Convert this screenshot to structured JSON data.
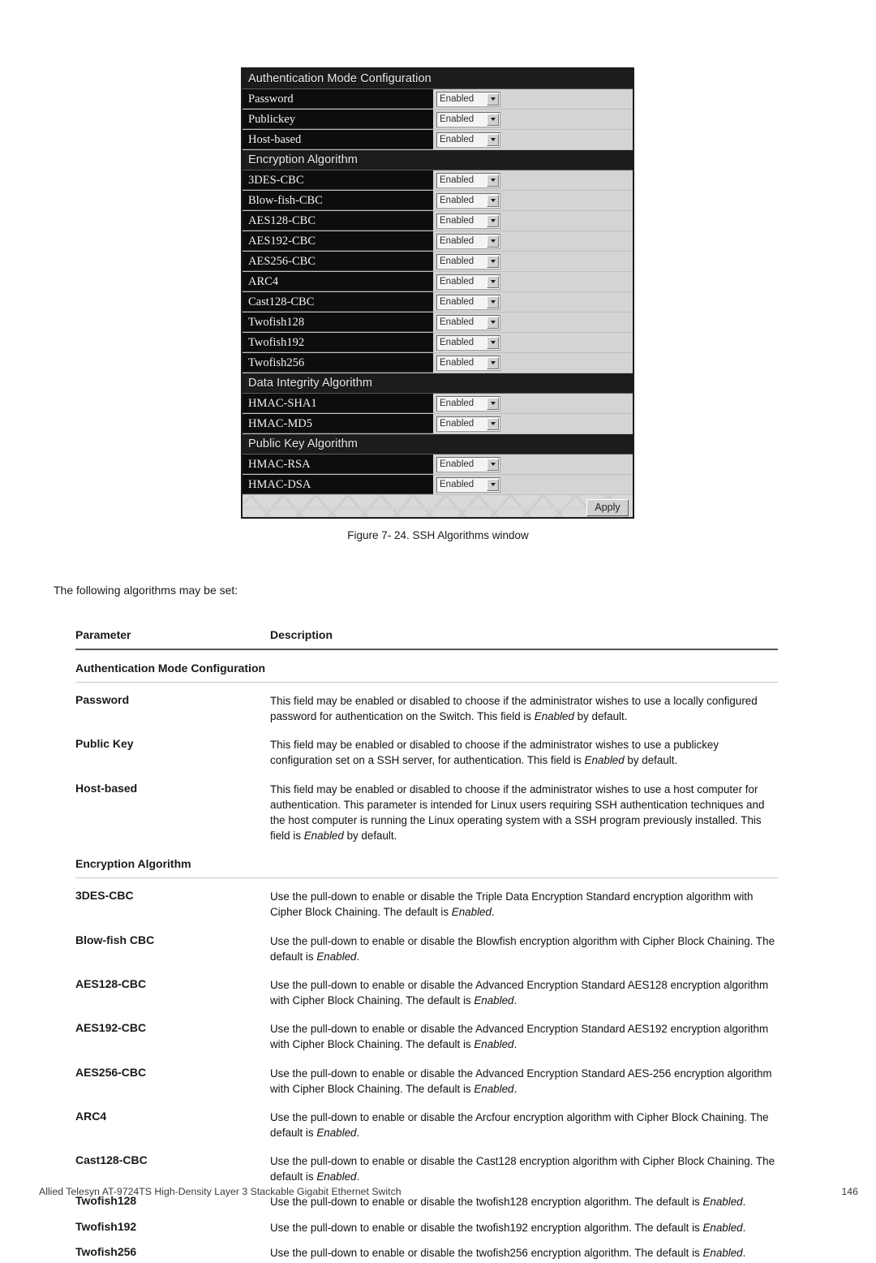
{
  "figure": {
    "caption": "Figure 7- 24. SSH Algorithms window",
    "apply_label": "Apply",
    "sections": [
      {
        "title": "Authentication Mode Configuration",
        "rows": [
          {
            "label": "Password",
            "value": "Enabled"
          },
          {
            "label": "Publickey",
            "value": "Enabled"
          },
          {
            "label": "Host-based",
            "value": "Enabled"
          }
        ]
      },
      {
        "title": "Encryption Algorithm",
        "rows": [
          {
            "label": "3DES-CBC",
            "value": "Enabled"
          },
          {
            "label": "Blow-fish-CBC",
            "value": "Enabled"
          },
          {
            "label": "AES128-CBC",
            "value": "Enabled"
          },
          {
            "label": "AES192-CBC",
            "value": "Enabled"
          },
          {
            "label": "AES256-CBC",
            "value": "Enabled"
          },
          {
            "label": "ARC4",
            "value": "Enabled"
          },
          {
            "label": "Cast128-CBC",
            "value": "Enabled"
          },
          {
            "label": "Twofish128",
            "value": "Enabled"
          },
          {
            "label": "Twofish192",
            "value": "Enabled"
          },
          {
            "label": "Twofish256",
            "value": "Enabled"
          }
        ]
      },
      {
        "title": "Data Integrity Algorithm",
        "rows": [
          {
            "label": "HMAC-SHA1",
            "value": "Enabled"
          },
          {
            "label": "HMAC-MD5",
            "value": "Enabled"
          }
        ]
      },
      {
        "title": "Public Key Algorithm",
        "rows": [
          {
            "label": "HMAC-RSA",
            "value": "Enabled"
          },
          {
            "label": "HMAC-DSA",
            "value": "Enabled"
          }
        ]
      }
    ]
  },
  "intro": "The following algorithms may be set:",
  "table": {
    "header": {
      "parameter": "Parameter",
      "description": "Description"
    },
    "groups": [
      {
        "title": "Authentication Mode Configuration",
        "rows": [
          {
            "parameter": "Password",
            "description": "This field may be enabled or disabled to choose if the administrator wishes to use a locally configured password for authentication on the Switch. This field is <em>Enabled</em> by default."
          },
          {
            "parameter": "Public Key",
            "description": "This field may be enabled or disabled to choose if the administrator wishes to use a publickey configuration set on a SSH server, for authentication. This field is <em>Enabled</em> by default."
          },
          {
            "parameter": "Host-based",
            "description": "This field may be enabled or disabled to choose if the administrator wishes to use a host computer for authentication. This parameter is intended for Linux users requiring SSH authentication techniques and the host computer is running the Linux operating system with a SSH program previously installed. This field is <em>Enabled</em> by default."
          }
        ]
      },
      {
        "title": "Encryption Algorithm",
        "rows": [
          {
            "parameter": "3DES-CBC",
            "description": "Use the pull-down to enable or disable the Triple Data Encryption Standard encryption algorithm with Cipher Block Chaining. The default is <em>Enabled</em>."
          },
          {
            "parameter": "Blow-fish CBC",
            "description": "Use the pull-down to enable or disable the Blowfish encryption algorithm with Cipher Block Chaining. The default is <em>Enabled</em>."
          },
          {
            "parameter": "AES128-CBC",
            "description": "Use the pull-down to enable or disable the Advanced Encryption Standard AES128 encryption algorithm with Cipher Block Chaining. The default is <em>Enabled</em>."
          },
          {
            "parameter": "AES192-CBC",
            "description": "Use the pull-down to enable or disable the Advanced Encryption Standard AES192 encryption algorithm with Cipher Block Chaining. The default is <em>Enabled</em>."
          },
          {
            "parameter": "AES256-CBC",
            "description": "Use the pull-down to enable or disable the Advanced Encryption Standard AES-256 encryption algorithm with Cipher Block Chaining. The default is <em>Enabled</em>."
          },
          {
            "parameter": "ARC4",
            "description": "Use the pull-down to enable or disable the Arcfour encryption algorithm with Cipher Block Chaining. The default is <em>Enabled</em>."
          },
          {
            "parameter": "Cast128-CBC",
            "description": "Use the pull-down to enable or disable the Cast128 encryption algorithm with Cipher Block Chaining. The default is <em>Enabled</em>."
          },
          {
            "parameter": "Twofish128",
            "description": "Use the pull-down to enable or disable the twofish128 encryption algorithm. The default is <em>Enabled</em>."
          },
          {
            "parameter": "Twofish192",
            "description": "Use the pull-down to enable or disable the twofish192 encryption algorithm. The default is <em>Enabled</em>."
          },
          {
            "parameter": "Twofish256",
            "description": "Use the pull-down to enable or disable the twofish256 encryption algorithm. The default is <em>Enabled</em>."
          }
        ]
      }
    ]
  },
  "footer": {
    "product": "Allied Telesyn AT-9724TS High-Density Layer 3 Stackable Gigabit Ethernet Switch",
    "page_number": "146"
  }
}
